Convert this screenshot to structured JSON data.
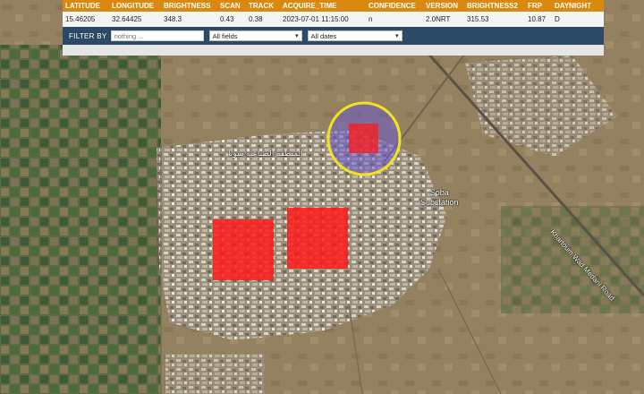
{
  "table": {
    "columns": [
      "LATITUDE",
      "LONGITUDE",
      "BRIGHTNESS",
      "SCAN",
      "TRACK",
      "ACQUIRE_TIME",
      "CONFIDENCE",
      "VERSION",
      "BRIGHTNESS2",
      "FRP",
      "DAYNIGHT"
    ],
    "rows": [
      [
        "15.46205",
        "32.64425",
        "348.3",
        "0.43",
        "0.38",
        "2023-07-01 11:15:00",
        "n",
        "2.0NRT",
        "315.53",
        "10.87",
        "D"
      ]
    ]
  },
  "filter": {
    "label": "FILTER BY",
    "placeholder": "nothing ...",
    "field_select": "All fields",
    "date_select": "All dates"
  },
  "map": {
    "labels": {
      "substation_line1": "Soba",
      "substation_line2": "Substation",
      "highway": "Khartoum Wad Medani Road",
      "arabic_area": "المنطقة الصناعية سوبا"
    },
    "colors": {
      "fire_square": "#ff1a1a",
      "highlight_ring": "#f2e21c",
      "highlight_fill": "#6a5acd",
      "header": "#d9890f",
      "filterbar": "#2b4a66"
    }
  }
}
